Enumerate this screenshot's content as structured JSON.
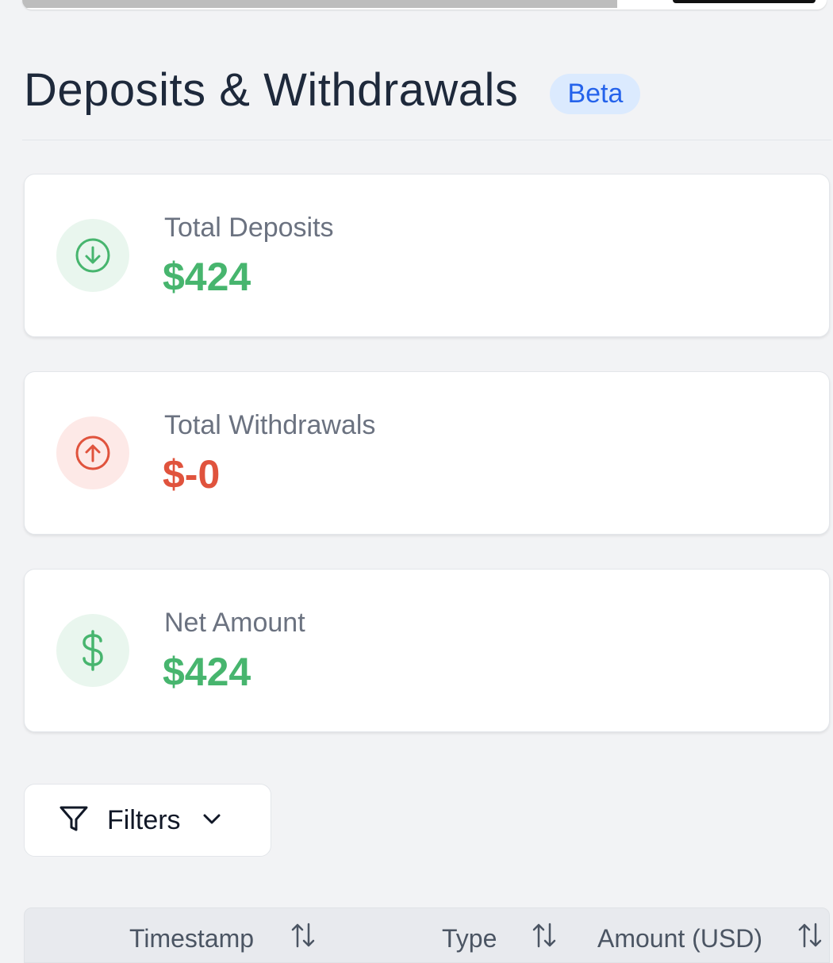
{
  "page": {
    "title": "Deposits & Withdrawals",
    "badge": "Beta",
    "scroll_progress": 0.74
  },
  "summary": {
    "deposits": {
      "label": "Total Deposits",
      "value": "$424",
      "icon": "arrow-down-circle-icon",
      "color": "#47b56e"
    },
    "withdrawals": {
      "label": "Total Withdrawals",
      "value": "$-0",
      "icon": "arrow-up-circle-icon",
      "color": "#e0533d"
    },
    "net": {
      "label": "Net Amount",
      "value": "$424",
      "icon": "dollar-sign-icon",
      "color": "#47b56e"
    }
  },
  "filters": {
    "label": "Filters",
    "icon": "filter-icon",
    "chevron": "chevron-down-icon"
  },
  "table": {
    "columns": [
      {
        "label": "Timestamp",
        "sort_icon": "sort-icon"
      },
      {
        "label": "Type",
        "sort_icon": "sort-icon"
      },
      {
        "label": "Amount (USD)",
        "sort_icon": "sort-icon"
      }
    ]
  },
  "colors": {
    "background": "#f2f3f5",
    "badge_bg": "#dbeafe",
    "badge_text": "#2563eb"
  }
}
